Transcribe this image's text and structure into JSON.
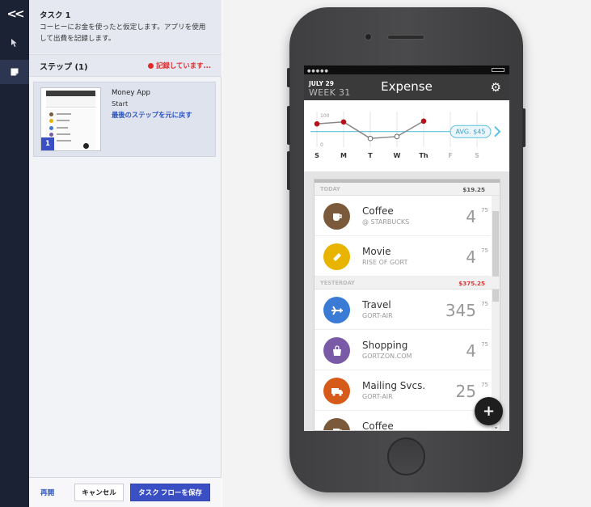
{
  "rail": {
    "collapse_icon": "double-chevron-left-icon",
    "tools": [
      {
        "name": "cursor-tool-icon"
      },
      {
        "name": "sticky-note-icon",
        "active": true
      }
    ]
  },
  "task": {
    "title": "タスク 1",
    "description": "コーヒーにお金を使ったと仮定します。アプリを使用して出費を記録します。"
  },
  "steps": {
    "header": "ステップ (1)",
    "status": "記録しています...",
    "status_color": "#e02b2b",
    "items": [
      {
        "number": "1",
        "app": "Money App",
        "state": "Start",
        "undo_label": "最後のステップを元に戻す"
      }
    ]
  },
  "footer": {
    "resume_label": "再開",
    "cancel_label": "キャンセル",
    "save_label": "タスク フローを保存",
    "accent": "#3b4fc4"
  },
  "app": {
    "date_top": "JULY 29",
    "date_week": "WEEK 31",
    "title": "Expense",
    "settings_icon": "gear-icon",
    "add_icon": "plus-icon"
  },
  "chart_data": {
    "type": "line",
    "categories": [
      "S",
      "M",
      "T",
      "W",
      "Th",
      "F",
      "S"
    ],
    "values": [
      73,
      80,
      20,
      27,
      83,
      null,
      null
    ],
    "y_ticks": [
      0,
      100
    ],
    "ylim": [
      0,
      100
    ],
    "average": 45,
    "average_label": "AVG. $45",
    "next_icon": "chevron-right-icon",
    "colors": {
      "line": "#888888",
      "high_point": "#b5121b",
      "avg_line": "#5bc0de"
    }
  },
  "list": {
    "sections": [
      {
        "label": "TODAY",
        "total": "$19.25",
        "total_color": "#555555",
        "rows": [
          {
            "name": "Coffee",
            "sub": "@ STARBUCKS",
            "amount": "4",
            "cents": "75",
            "icon": "coffee-cup-icon",
            "color": "#7a5a3a"
          },
          {
            "name": "Movie",
            "sub": "RISE OF GORT",
            "amount": "4",
            "cents": "75",
            "icon": "ticket-icon",
            "color": "#e8b400"
          }
        ]
      },
      {
        "label": "YESTERDAY",
        "total": "$375.25",
        "total_color": "#dd3333",
        "rows": [
          {
            "name": "Travel",
            "sub": "GORT-AIR",
            "amount": "345",
            "cents": "75",
            "icon": "airplane-icon",
            "color": "#3a7bd5"
          },
          {
            "name": "Shopping",
            "sub": "GORTZON.COM",
            "amount": "4",
            "cents": "75",
            "icon": "shopping-bag-icon",
            "color": "#7a5aa6"
          },
          {
            "name": "Mailing Svcs.",
            "sub": "GORT-AIR",
            "amount": "25",
            "cents": "75",
            "icon": "truck-icon",
            "color": "#d65a1a"
          },
          {
            "name": "Coffee",
            "sub": "",
            "amount": "",
            "cents": "",
            "icon": "coffee-cup-icon",
            "color": "#7a5a3a"
          }
        ]
      }
    ]
  }
}
